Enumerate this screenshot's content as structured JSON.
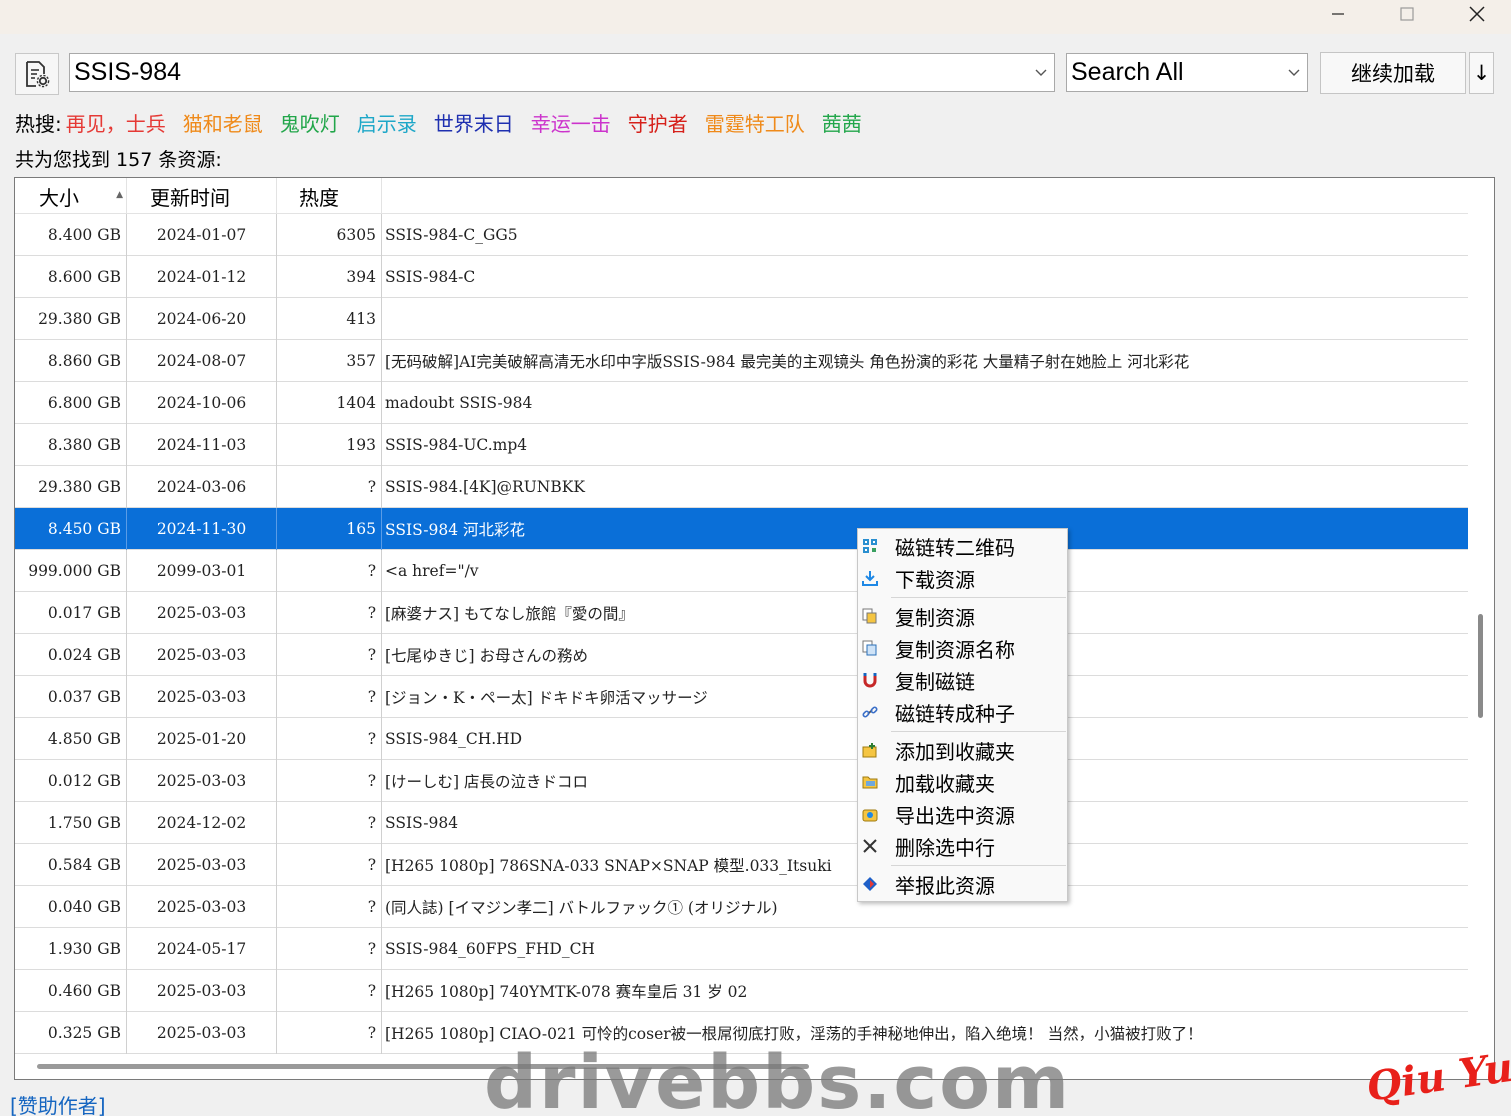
{
  "window": {
    "minimize": "—",
    "maximize": "☐",
    "close": "✕"
  },
  "search": {
    "query": "SSIS-984",
    "scope": "Search All",
    "load_more_label": "继续加载",
    "down_label": "↓"
  },
  "hot": {
    "label": "热搜:",
    "items": [
      {
        "text": "再见，士兵",
        "color": "#e53935"
      },
      {
        "text": "猫和老鼠",
        "color": "#ef8a1a"
      },
      {
        "text": "鬼吹灯",
        "color": "#22a64a"
      },
      {
        "text": "启示录",
        "color": "#1ea7c8"
      },
      {
        "text": "世界末日",
        "color": "#1e2fb0"
      },
      {
        "text": "幸运一击",
        "color": "#cc33cc"
      },
      {
        "text": "守护者",
        "color": "#d6201a"
      },
      {
        "text": "雷霆特工队",
        "color": "#ef8a1a"
      },
      {
        "text": "茜茜",
        "color": "#22a64a"
      }
    ]
  },
  "result_text": "共为您找到 157 条资源:",
  "columns": {
    "size": "大小",
    "date": "更新时间",
    "heat": "热度",
    "name": ""
  },
  "rows": [
    {
      "size": "8.400 GB",
      "date": "2024-01-07",
      "heat": "6305",
      "name": "SSIS-984-C_GG5"
    },
    {
      "size": "8.600 GB",
      "date": "2024-01-12",
      "heat": "394",
      "name": "SSIS-984-C"
    },
    {
      "size": "29.380 GB",
      "date": "2024-06-20",
      "heat": "413",
      "name": ""
    },
    {
      "size": "8.860 GB",
      "date": "2024-08-07",
      "heat": "357",
      "name": "[无码破解]AI完美破解高清无水印中字版SSIS-984 最完美的主观镜头 角色扮演的彩花 大量精子射在她脸上 河北彩花"
    },
    {
      "size": "6.800 GB",
      "date": "2024-10-06",
      "heat": "1404",
      "name": "madoubt  SSIS-984"
    },
    {
      "size": "8.380 GB",
      "date": "2024-11-03",
      "heat": "193",
      "name": "SSIS-984-UC.mp4"
    },
    {
      "size": "29.380 GB",
      "date": "2024-03-06",
      "heat": "?",
      "name": "SSIS-984.[4K]@RUNBKK"
    },
    {
      "size": "8.450 GB",
      "date": "2024-11-30",
      "heat": "165",
      "name": "SSIS-984  河北彩花"
    },
    {
      "size": "999.000 GB",
      "date": "2099-03-01",
      "heat": "?",
      "name": "<a href=\"/v"
    },
    {
      "size": "0.017 GB",
      "date": "2025-03-03",
      "heat": "?",
      "name": "[麻婆ナス] もてなし旅館『愛の間』"
    },
    {
      "size": "0.024 GB",
      "date": "2025-03-03",
      "heat": "?",
      "name": "[七尾ゆきじ] お母さんの務め"
    },
    {
      "size": "0.037 GB",
      "date": "2025-03-03",
      "heat": "?",
      "name": "[ジョン・K・ペー太] ドキドキ卵活マッサージ"
    },
    {
      "size": "4.850 GB",
      "date": "2025-01-20",
      "heat": "?",
      "name": "SSIS-984_CH.HD"
    },
    {
      "size": "0.012 GB",
      "date": "2025-03-03",
      "heat": "?",
      "name": "[けーしむ] 店長の泣きドコロ"
    },
    {
      "size": "1.750 GB",
      "date": "2024-12-02",
      "heat": "?",
      "name": "SSIS-984"
    },
    {
      "size": "0.584 GB",
      "date": "2025-03-03",
      "heat": "?",
      "name": "[H265 1080p] 786SNA-033 SNAP×SNAP 模型.033_Itsuki"
    },
    {
      "size": "0.040 GB",
      "date": "2025-03-03",
      "heat": "?",
      "name": "(同人誌) [イマジン孝二] バトルファック① (オリジナル)"
    },
    {
      "size": "1.930 GB",
      "date": "2024-05-17",
      "heat": "?",
      "name": "SSIS-984_60FPS_FHD_CH"
    },
    {
      "size": "0.460 GB",
      "date": "2025-03-03",
      "heat": "?",
      "name": "[H265 1080p] 740YMTK-078 赛车皇后 31 岁 02"
    },
    {
      "size": "0.325 GB",
      "date": "2025-03-03",
      "heat": "?",
      "name": "[H265 1080p] CIAO-021 可怜的coser被一根屌彻底打败，淫荡的手神秘地伸出，陷入绝境！ 当然，小猫被打败了！"
    }
  ],
  "selected_row": 7,
  "context_menu": {
    "qr": "磁链转二维码",
    "download": "下载资源",
    "copy_resource": "复制资源",
    "copy_name": "复制资源名称",
    "copy_magnet": "复制磁链",
    "to_torrent": "磁链转成种子",
    "add_fav": "添加到收藏夹",
    "load_fav": "加载收藏夹",
    "export": "导出选中资源",
    "delete": "删除选中行",
    "report": "举报此资源"
  },
  "sponsor": "[赞助作者]",
  "watermark": "drivebbs.com",
  "watermark2": "Qiu Yue"
}
